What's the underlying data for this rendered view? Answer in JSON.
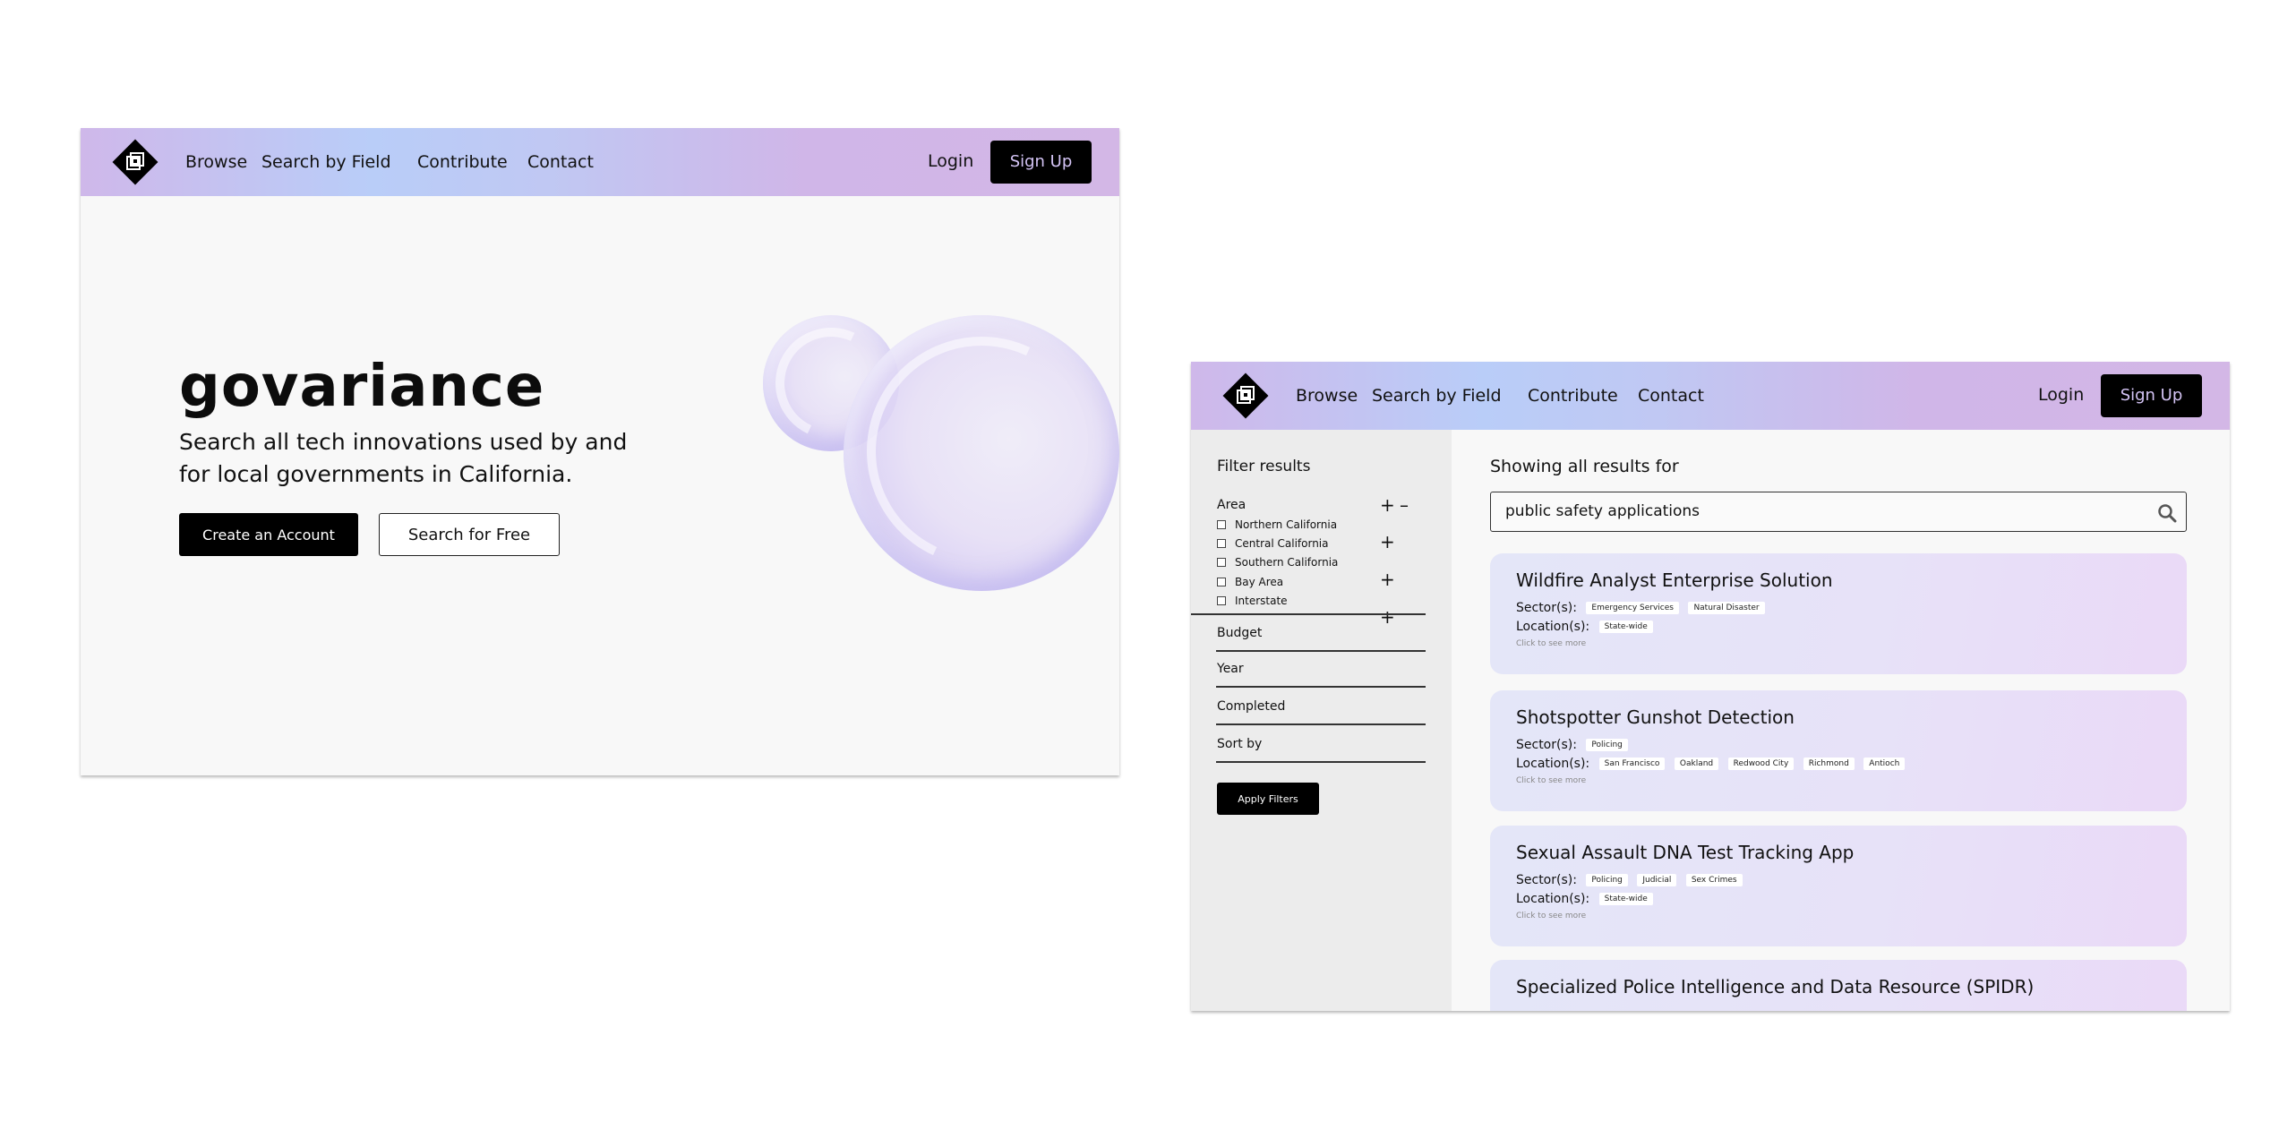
{
  "nav": {
    "browse": "Browse",
    "search_by_field": "Search by Field",
    "contribute": "Contribute",
    "contact": "Contact",
    "login": "Login",
    "signup": "Sign Up"
  },
  "home": {
    "title": "govariance",
    "subtitle": "Search all tech innovations used by and for local governments in California.",
    "create_account": "Create an Account",
    "search_free": "Search for Free"
  },
  "results": {
    "filter_title": "Filter results",
    "area_label": "Area",
    "area_options": [
      "Northern California",
      "Central California",
      "Southern California",
      "Bay Area",
      "Interstate"
    ],
    "sections": [
      "Budget",
      "Year",
      "Completed",
      "Sort by"
    ],
    "apply_label": "Apply Filters",
    "showing_label": "Showing all results for",
    "search_value": "public safety applications",
    "sector_label": "Sector(s):",
    "location_label": "Location(s):",
    "more_label": "Click to see more",
    "cards": [
      {
        "title": "Wildfire Analyst Enterprise Solution",
        "sectors": [
          "Emergency Services",
          "Natural Disaster"
        ],
        "locations": [
          "State-wide"
        ]
      },
      {
        "title": "Shotspotter Gunshot Detection",
        "sectors": [
          "Policing"
        ],
        "locations": [
          "San Francisco",
          "Oakland",
          "Redwood City",
          "Richmond",
          "Antioch"
        ]
      },
      {
        "title": "Sexual Assault DNA Test Tracking App",
        "sectors": [
          "Policing",
          "Judicial",
          "Sex Crimes"
        ],
        "locations": [
          "State-wide"
        ]
      },
      {
        "title": "Specialized Police Intelligence and Data Resource (SPIDR)"
      }
    ]
  },
  "icons": {
    "logo": "layers-diamond-logo",
    "search": "search-icon",
    "plus": "+",
    "minus": "–"
  }
}
